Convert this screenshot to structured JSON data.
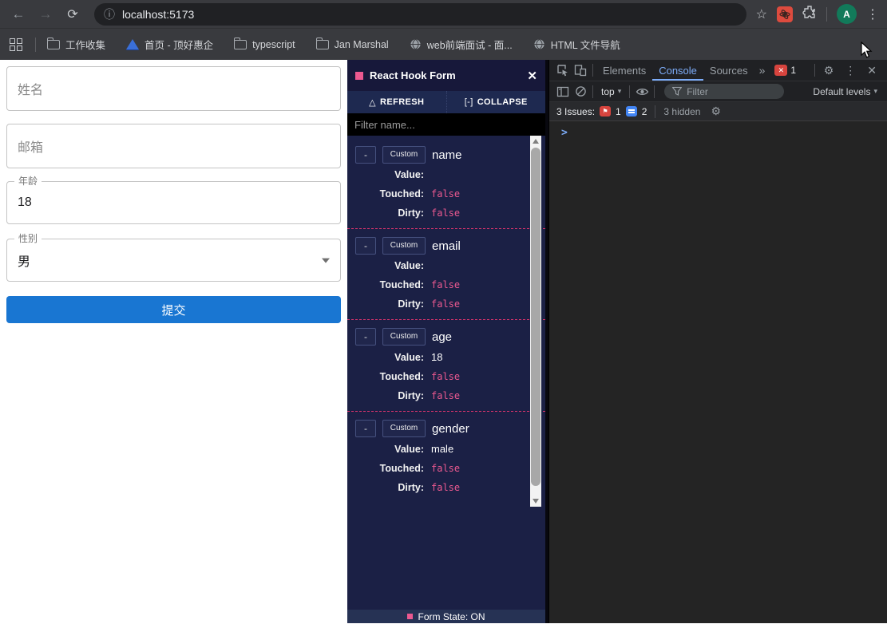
{
  "colors": {
    "accent_pink": "#ec5990",
    "submit_blue": "#1976d2",
    "console_active_blue": "#7cacf8",
    "error_red": "#d7443e",
    "issue_blue": "#4285f4"
  },
  "icons": {
    "back": "←",
    "forward": "→",
    "reload": "⟳",
    "info": "ⓘ",
    "star": "☆",
    "menu_dots": "⋮",
    "gear": "⚙",
    "close": "✕",
    "more_tabs": "»",
    "caret_down": "▾",
    "refresh_triangle": "△",
    "collapse_bracket": "[-]"
  },
  "browser": {
    "url": "localhost:5173",
    "avatar_letter": "A",
    "bookmarks": [
      {
        "label": "工作收集",
        "icon": "folder"
      },
      {
        "label": "首页 - 顶好惠企",
        "icon": "site-blue"
      },
      {
        "label": "typescript",
        "icon": "folder"
      },
      {
        "label": "Jan Marshal",
        "icon": "folder"
      },
      {
        "label": "web前端面试 - 面...",
        "icon": "globe"
      },
      {
        "label": "HTML 文件导航",
        "icon": "globe"
      }
    ]
  },
  "form": {
    "fields": [
      {
        "label": "姓名",
        "value": ""
      },
      {
        "label": "邮箱",
        "value": ""
      },
      {
        "label": "年龄",
        "value": "18"
      },
      {
        "label": "性别",
        "value": "男"
      }
    ],
    "submit_label": "提交"
  },
  "rhf": {
    "title": "React Hook Form",
    "actions": {
      "refresh": "REFRESH",
      "collapse": "COLLAPSE"
    },
    "filter_placeholder": "Filter name...",
    "row_labels": {
      "value": "Value:",
      "touched": "Touched:",
      "dirty": "Dirty:"
    },
    "entries": [
      {
        "minus": "-",
        "badge": "Custom",
        "name": "name",
        "value": "",
        "touched": "false",
        "dirty": "false"
      },
      {
        "minus": "-",
        "badge": "Custom",
        "name": "email",
        "value": "",
        "touched": "false",
        "dirty": "false"
      },
      {
        "minus": "-",
        "badge": "Custom",
        "name": "age",
        "value": "18",
        "touched": "false",
        "dirty": "false"
      },
      {
        "minus": "-",
        "badge": "Custom",
        "name": "gender",
        "value": "male",
        "touched": "false",
        "dirty": "false"
      }
    ],
    "footer": "Form State: ON"
  },
  "devtools": {
    "tabs": [
      "Elements",
      "Console",
      "Sources"
    ],
    "active_tab": "Console",
    "error_count": "1",
    "toolbar": {
      "context": "top",
      "filter_placeholder": "Filter",
      "levels": "Default levels"
    },
    "issues": {
      "label": "3 Issues:",
      "errors": "1",
      "warnings": "2",
      "hidden": "3 hidden"
    },
    "prompt": ">"
  }
}
